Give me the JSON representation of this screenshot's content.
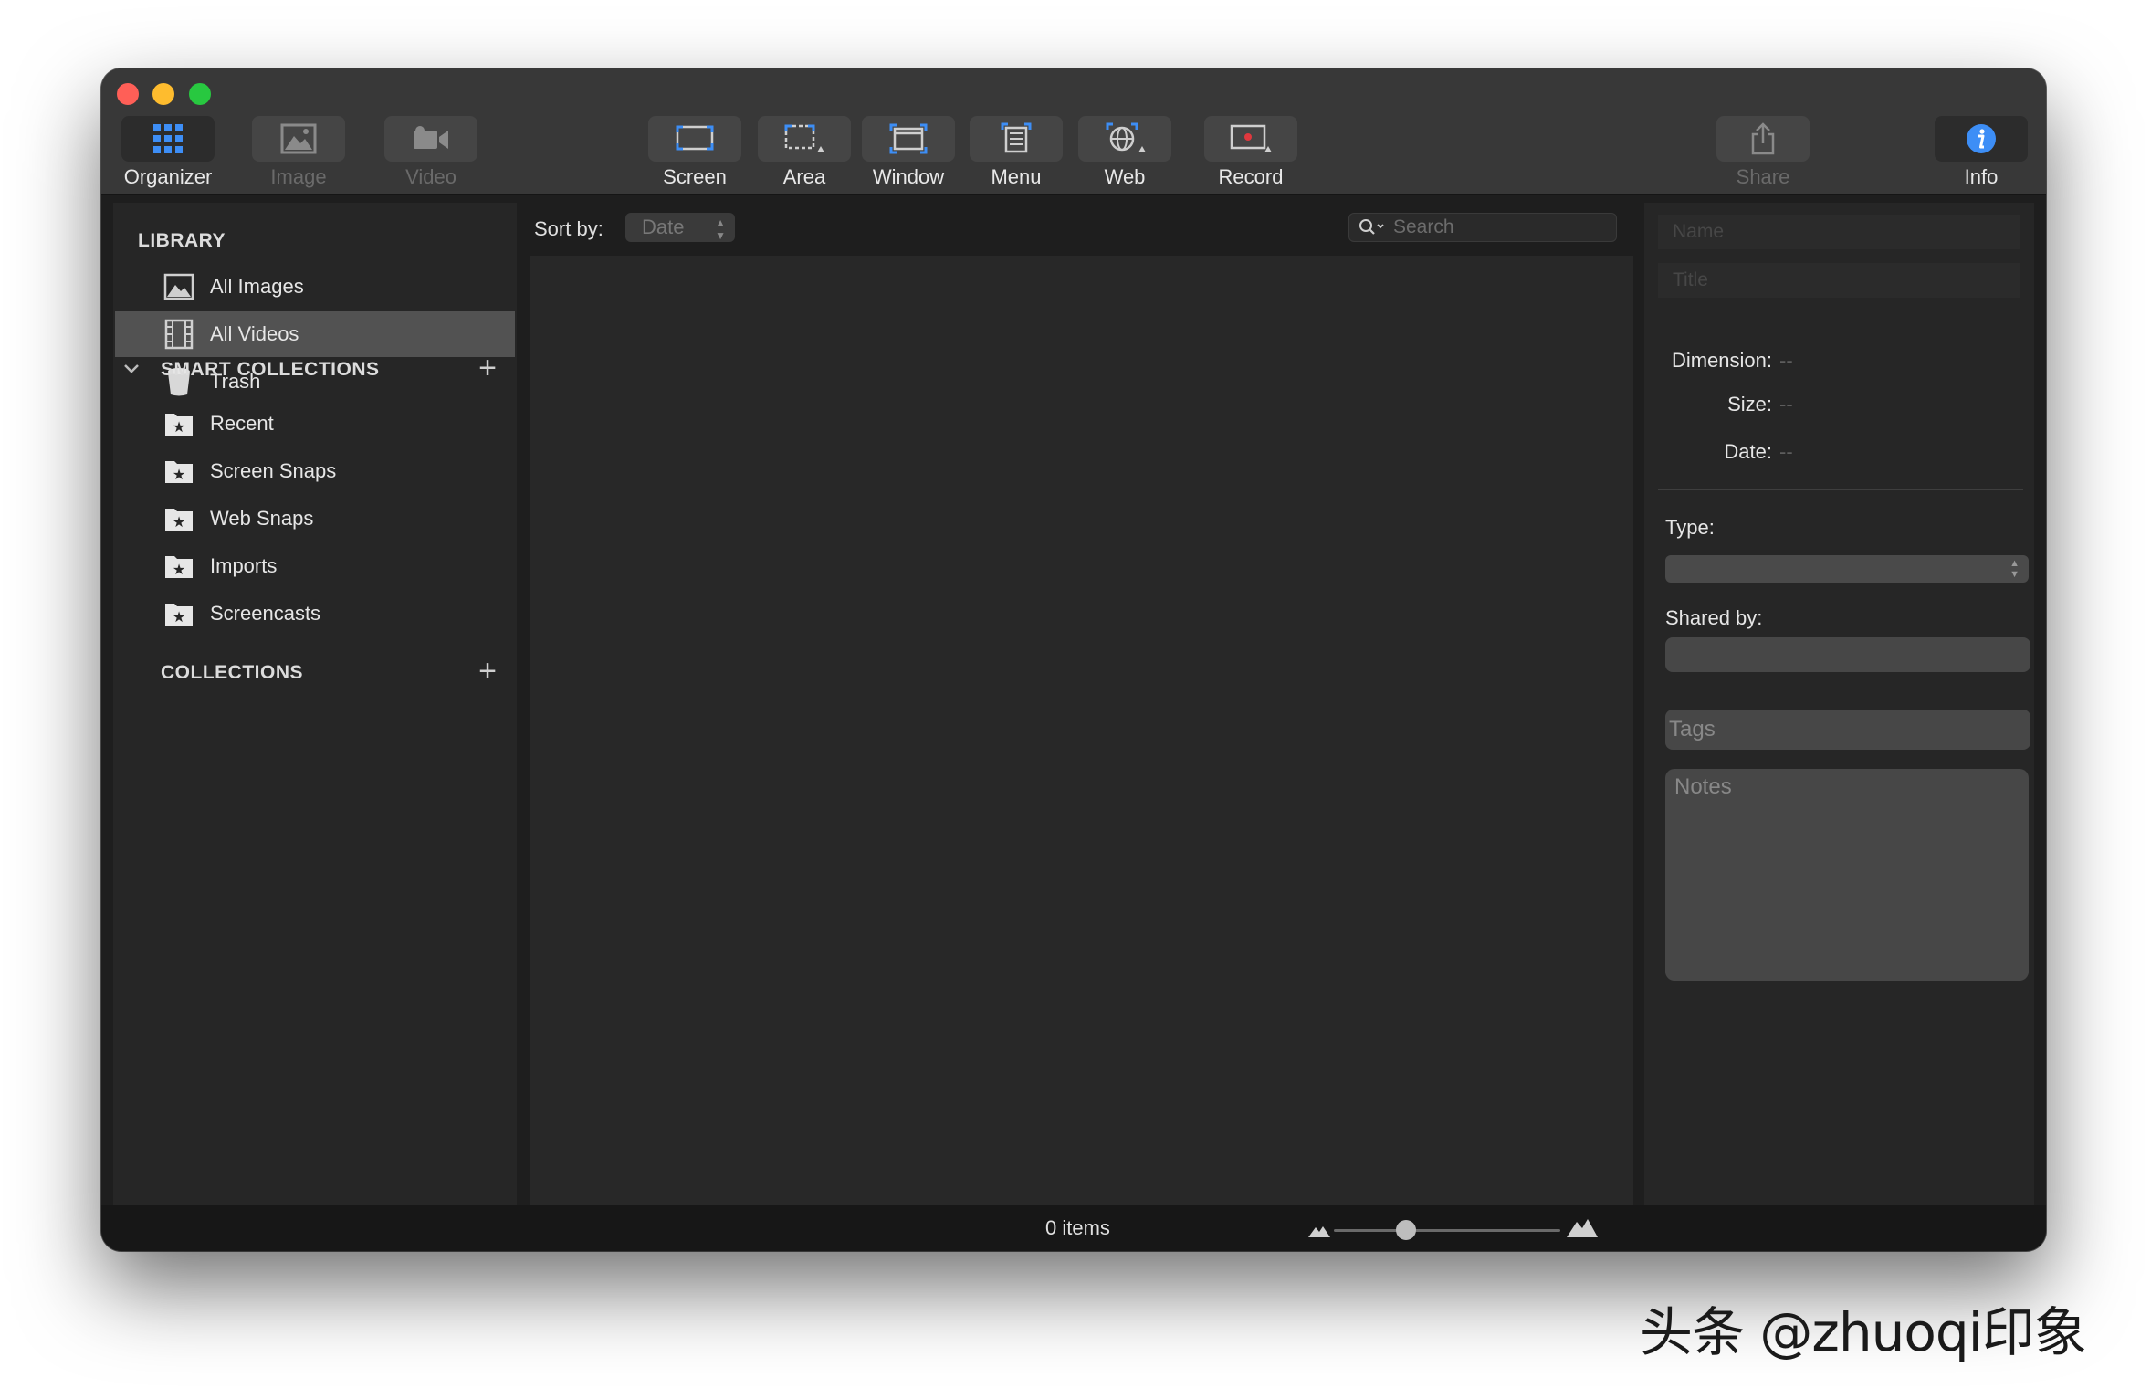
{
  "toolbar": {
    "items": [
      {
        "label": "Organizer",
        "icon": "grid-icon",
        "state": "active"
      },
      {
        "label": "Image",
        "icon": "image-icon",
        "state": "disabled"
      },
      {
        "label": "Video",
        "icon": "video-camera-icon",
        "state": "disabled"
      },
      {
        "label": "Screen",
        "icon": "screen-capture-icon"
      },
      {
        "label": "Area",
        "icon": "area-capture-icon"
      },
      {
        "label": "Window",
        "icon": "window-capture-icon"
      },
      {
        "label": "Menu",
        "icon": "menu-capture-icon"
      },
      {
        "label": "Web",
        "icon": "web-capture-icon"
      },
      {
        "label": "Record",
        "icon": "record-icon"
      },
      {
        "label": "Share",
        "icon": "share-icon",
        "state": "disabled"
      },
      {
        "label": "Info",
        "icon": "info-icon"
      }
    ]
  },
  "sidebar": {
    "library_title": "LIBRARY",
    "library_items": [
      {
        "label": "All Images",
        "icon": "photo-icon"
      },
      {
        "label": "All Videos",
        "icon": "film-strip-icon",
        "selected": true
      },
      {
        "label": "Trash",
        "icon": "trash-icon"
      }
    ],
    "smart_title": "SMART COLLECTIONS",
    "smart_items": [
      {
        "label": "Recent",
        "icon": "smart-folder-icon"
      },
      {
        "label": "Screen Snaps",
        "icon": "smart-folder-icon"
      },
      {
        "label": "Web Snaps",
        "icon": "smart-folder-icon"
      },
      {
        "label": "Imports",
        "icon": "smart-folder-icon"
      },
      {
        "label": "Screencasts",
        "icon": "smart-folder-icon"
      }
    ],
    "collections_title": "COLLECTIONS"
  },
  "main": {
    "sort_label": "Sort by:",
    "sort_value": "Date",
    "search_placeholder": "Search"
  },
  "inspector": {
    "name_placeholder": "Name",
    "title_placeholder": "Title",
    "dimension_label": "Dimension:",
    "dimension_value": "--",
    "size_label": "Size:",
    "size_value": "--",
    "date_label": "Date:",
    "date_value": "--",
    "type_label": "Type:",
    "shared_label": "Shared by:",
    "tags_placeholder": "Tags",
    "notes_placeholder": "Notes"
  },
  "status": {
    "items_count": "0 items",
    "zoom_fraction": 0.32
  },
  "watermark": "头条 @zhuoqi印象",
  "colors": {
    "accent_blue": "#3d8ef6",
    "record_red": "#e0383e",
    "selection": "#525252"
  }
}
